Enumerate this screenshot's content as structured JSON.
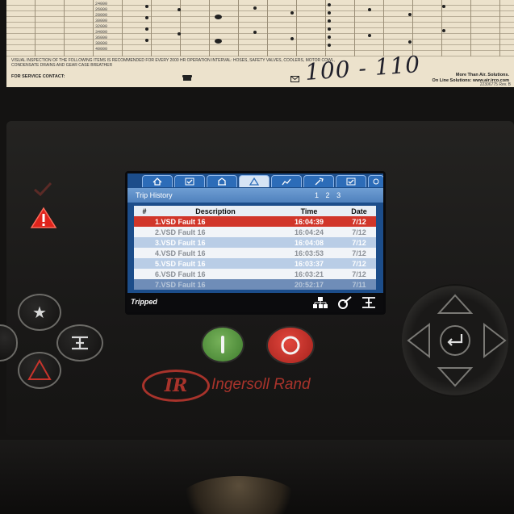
{
  "paper": {
    "mileage_values": [
      "24000",
      "26000",
      "28000",
      "30000",
      "32000",
      "34000",
      "36000",
      "38000",
      "40000"
    ],
    "inspection_note": "VISUAL INSPECTION OF THE FOLLOWING ITEMS IS RECOMMENDED FOR EVERY 2000 HR OPERATION INTERVAL: HOSES, SAFETY VALVES, COOLERS, MOTOR COWL, CONDENSATE DRAINS AND GEAR CASE BREATHER",
    "contact_label": "FOR SERVICE CONTACT:",
    "handwriting": "100 - 110",
    "right_line1": "More Than Air. Solutions.",
    "right_line2": "On Line Solutions: www.air.irco.com",
    "code": "22306775 Rev. B"
  },
  "screen": {
    "tabs": [
      "home-icon",
      "check-icon",
      "building-icon",
      "alarm-icon",
      "chart-icon",
      "wrench-icon",
      "checkbox-icon",
      "settings-icon"
    ],
    "title": "Trip History",
    "pages": [
      "1",
      "2",
      "3"
    ],
    "columns": {
      "num": "#",
      "description": "Description",
      "time": "Time",
      "date": "Date"
    },
    "rows": [
      {
        "description": "1.VSD Fault 16",
        "time": "16:04:39",
        "date": "7/12",
        "style": "sel"
      },
      {
        "description": "2.VSD Fault 16",
        "time": "16:04:24",
        "date": "7/12",
        "style": "light"
      },
      {
        "description": "3.VSD Fault 16",
        "time": "16:04:08",
        "date": "7/12",
        "style": "blue"
      },
      {
        "description": "4.VSD Fault 16",
        "time": "16:03:53",
        "date": "7/12",
        "style": "light"
      },
      {
        "description": "5.VSD Fault 16",
        "time": "16:03:37",
        "date": "7/12",
        "style": "blue"
      },
      {
        "description": "6.VSD Fault 16",
        "time": "16:03:21",
        "date": "7/12",
        "style": "light"
      },
      {
        "description": "7.VSD Fault 16",
        "time": "20:52:17",
        "date": "7/11",
        "style": "dim"
      }
    ],
    "status_text": "Tripped",
    "status_icons": [
      "network-icon",
      "wrench-gear-icon",
      "pressure-icon"
    ]
  },
  "brand": {
    "logo": "IR",
    "name": "Ingersoll Rand",
    "color": "#a8332b"
  }
}
